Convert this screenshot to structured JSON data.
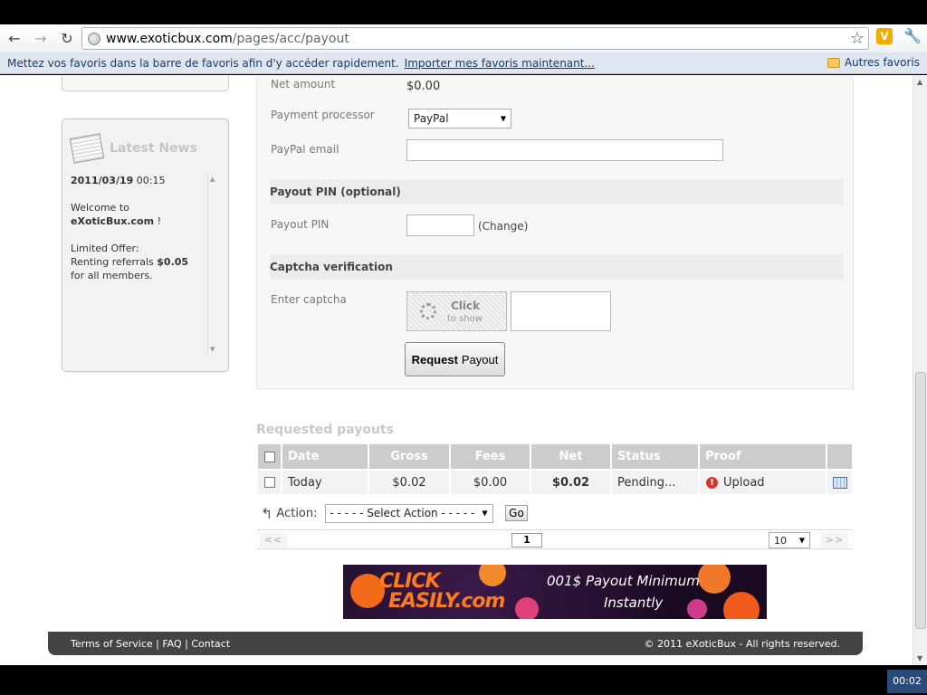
{
  "browser": {
    "url_host": "www.exoticbux.com",
    "url_path": "/pages/acc/payout",
    "bookmarks_message": "Mettez vos favoris dans la barre de favoris afin d'y accéder rapidement.",
    "import_link": "Importer mes favoris maintenant...",
    "other_bookmarks": "Autres favoris"
  },
  "news": {
    "title": "Latest News",
    "date": "2011/03/19",
    "time": "00:15",
    "welcome": "Welcome to",
    "site": "eXoticBux.com",
    "exclaim": " !",
    "offer_label": "Limited Offer:",
    "offer_text": "Renting referrals",
    "offer_price": "$0.05",
    "offer_suffix": "for all members."
  },
  "form": {
    "net_amount_label": "Net amount",
    "net_amount_value": "$0.00",
    "processor_label": "Payment processor",
    "processor_value": "PayPal",
    "paypal_email_label": "PayPal email",
    "paypal_email_value": "",
    "pin_section": "Payout PIN (optional)",
    "pin_label": "Payout PIN",
    "pin_value": "",
    "pin_change": "(Change)",
    "captcha_section": "Captcha verification",
    "captcha_label": "Enter captcha",
    "captcha_click": "Click",
    "captcha_show": "to show",
    "captcha_value": "",
    "request_bold": "Request",
    "request_rest": "Payout"
  },
  "payouts": {
    "title": "Requested payouts",
    "columns": [
      "Date",
      "Gross",
      "Fees",
      "Net",
      "Status",
      "Proof"
    ],
    "row": {
      "date": "Today",
      "gross": "$0.02",
      "fees": "$0.00",
      "net": "$0.02",
      "status": "Pending...",
      "proof": "Upload"
    },
    "action_label": "Action:",
    "action_value": "- - - - - Select Action - - - - -",
    "go": "Go",
    "prev": "<<",
    "next": ">>",
    "page": "1",
    "per_page": "10"
  },
  "banner": {
    "line1": "CLICK",
    "line2": "EASILY.com",
    "line3": "001$ Payout Minimum",
    "line4": "Instantly"
  },
  "footer": {
    "links": "Terms of Service | FAQ | Contact",
    "copyright": "© 2011 eXoticBux - All rights reserved."
  },
  "taskbar": {
    "clock": "00:02"
  }
}
